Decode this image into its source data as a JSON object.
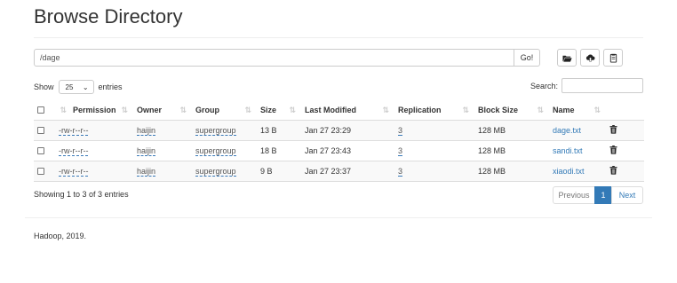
{
  "page_title": "Browse Directory",
  "path": {
    "value": "/dage",
    "go_label": "Go!"
  },
  "toolbar": {
    "icons": [
      "folder-open-icon",
      "upload-icon",
      "clipboard-icon"
    ]
  },
  "show": {
    "prefix": "Show",
    "selected": "25",
    "suffix": "entries"
  },
  "search": {
    "label": "Search:"
  },
  "table": {
    "headers": [
      "Permission",
      "Owner",
      "Group",
      "Size",
      "Last Modified",
      "Replication",
      "Block Size",
      "Name"
    ],
    "rows": [
      {
        "permission": "-rw-r--r--",
        "owner": "haijin",
        "group": "supergroup",
        "size": "13 B",
        "modified": "Jan 27 23:29",
        "replication": "3",
        "block_size": "128 MB",
        "name": "dage.txt"
      },
      {
        "permission": "-rw-r--r--",
        "owner": "haijin",
        "group": "supergroup",
        "size": "18 B",
        "modified": "Jan 27 23:43",
        "replication": "3",
        "block_size": "128 MB",
        "name": "sandi.txt"
      },
      {
        "permission": "-rw-r--r--",
        "owner": "haijin",
        "group": "supergroup",
        "size": "9 B",
        "modified": "Jan 27 23:37",
        "replication": "3",
        "block_size": "128 MB",
        "name": "xiaodi.txt"
      }
    ]
  },
  "info": "Showing 1 to 3 of 3 entries",
  "pagination": {
    "previous": "Previous",
    "current": "1",
    "next": "Next"
  },
  "footer": "Hadoop, 2019.",
  "colors": {
    "link": "#337ab7",
    "active_page": "#337ab7"
  }
}
